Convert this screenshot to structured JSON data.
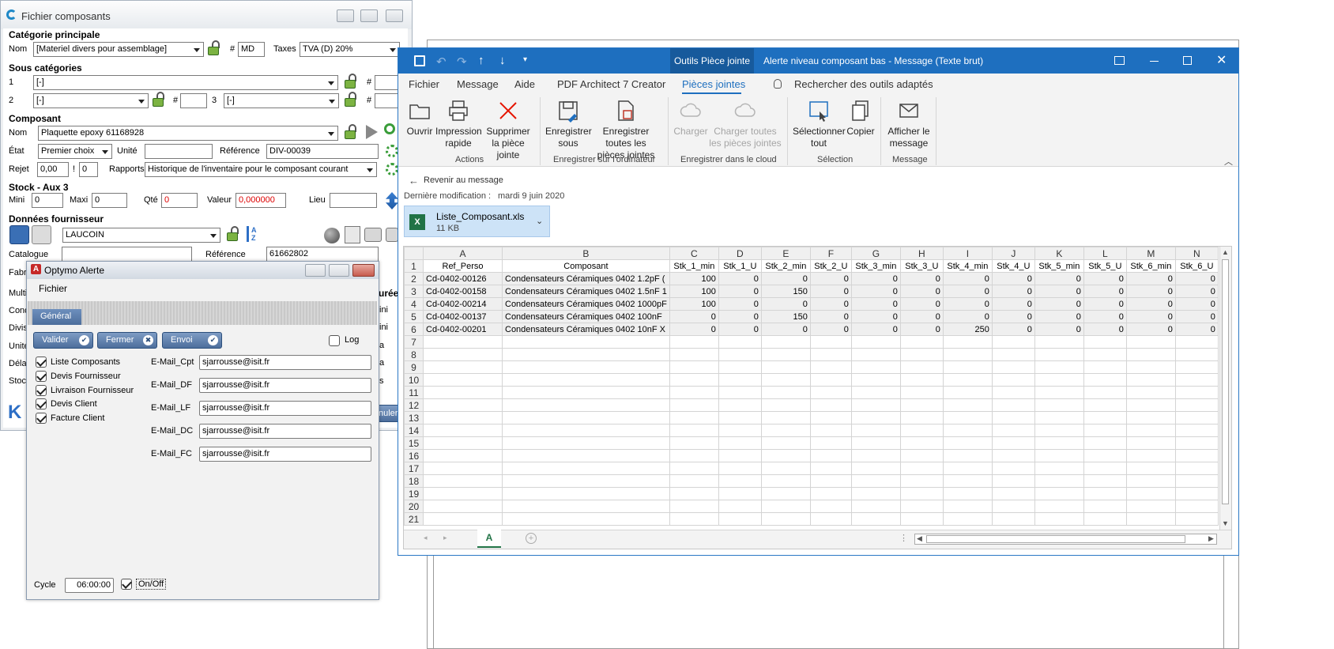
{
  "fichier": {
    "title": "Fichier composants",
    "cat_principale": "Catégorie principale",
    "nom_label": "Nom",
    "nom_value": "[Materiel divers pour assemblage]",
    "hash": "#",
    "md_value": "MD",
    "taxes_label": "Taxes",
    "taxes_value": "TVA (D) 20%",
    "sous_cat": "Sous catégories",
    "sc1_num": "1",
    "sc1_value": "[-]",
    "sc2_num": "2",
    "sc2_value": "[-]",
    "sc3_num": "3",
    "sc3_value": "[-]",
    "composant": "Composant",
    "comp_nom_value": "Plaquette epoxy 61168928",
    "etat_label": "État",
    "etat_value": "Premier choix",
    "unite_label": "Unité",
    "reference_label": "Référence",
    "reference_value": "DIV-00039",
    "rejet_label": "Rejet",
    "rejet_value": "0,00",
    "rejet_bang": "!",
    "rejet_value2": "0",
    "rapports_label": "Rapports",
    "rapports_value": "Historique de l'inventaire pour le composant courant",
    "stock": "Stock - Aux 3",
    "mini_label": "Mini",
    "mini_value": "0",
    "maxi_label": "Maxi",
    "maxi_value": "0",
    "qte_label": "Qté",
    "qte_value": "0",
    "valeur_label": "Valeur",
    "valeur_value": "0,000000",
    "lieu_label": "Lieu",
    "donnees_four": "Données fournisseur",
    "fournisseur_value": "LAUCOIN",
    "catalogue_label": "Catalogue",
    "reference2_value": "61662802",
    "side_labels": [
      "Fabr",
      "Multi",
      "Cond",
      "Divis",
      "Unité",
      "Délai",
      "Stocl"
    ],
    "duree": "urée",
    "right_frags": [
      "ini",
      "ini",
      "a",
      "a",
      "s"
    ],
    "annuler": "nuler"
  },
  "optymo": {
    "title": "Optymo Alerte",
    "menu": "Fichier",
    "tab": "Général",
    "valider": "Valider",
    "fermer": "Fermer",
    "envoi": "Envoi",
    "log": "Log",
    "checks": [
      "Liste Composants",
      "Devis Fournisseur",
      "Livraison Fournisseur",
      "Devis Client",
      "Facture Client"
    ],
    "email_labels": [
      "E-Mail_Cpt",
      "E-Mail_DF",
      "E-Mail_LF",
      "E-Mail_DC",
      "E-Mail_FC"
    ],
    "email_value": "sjarrousse@isit.fr",
    "cycle_label": "Cycle",
    "cycle_value": "06:00:00",
    "onoff": "On/Off"
  },
  "outlook": {
    "tools_tab": "Outils Pièce jointe",
    "title": "Alerte niveau composant bas  -  Message (Texte brut)",
    "tabs": [
      "Fichier",
      "Message",
      "Aide",
      "PDF Architect 7 Creator",
      "Pièces jointes"
    ],
    "search": "Rechercher des outils adaptés",
    "buttons": {
      "ouvrir": "Ouvrir",
      "impression": "Impression rapide",
      "supprimer": "Supprimer la pièce jointe",
      "enreg_sous": "Enregistrer sous",
      "enreg_toutes": "Enregistrer toutes les pièces jointes",
      "charger": "Charger",
      "charger_toutes": "Charger toutes les pièces jointes",
      "selectionner": "Sélectionner tout",
      "copier": "Copier",
      "afficher": "Afficher le message"
    },
    "groups": [
      "Actions",
      "Enregistrer sur l'ordinateur",
      "Enregistrer dans le cloud",
      "Sélection",
      "Message"
    ],
    "back": "Revenir au message",
    "modif_label": "Dernière modification :",
    "modif_value": "mardi 9 juin 2020",
    "attach_name": "Liste_Composant.xls",
    "attach_size": "11 KB",
    "sheet_tab": "A"
  },
  "sheet": {
    "col_letters": [
      "A",
      "B",
      "C",
      "D",
      "E",
      "F",
      "G",
      "H",
      "I",
      "J",
      "K",
      "L",
      "M",
      "N"
    ],
    "header": [
      "Ref_Perso",
      "Composant",
      "Stk_1_min",
      "Stk_1_U",
      "Stk_2_min",
      "Stk_2_U",
      "Stk_3_min",
      "Stk_3_U",
      "Stk_4_min",
      "Stk_4_U",
      "Stk_5_min",
      "Stk_5_U",
      "Stk_6_min",
      "Stk_6_U"
    ],
    "rows": [
      [
        "Cd-0402-00126",
        "Condensateurs Céramiques 0402 1.2pF (",
        "100",
        "0",
        "0",
        "0",
        "0",
        "0",
        "0",
        "0",
        "0",
        "0",
        "0",
        "0"
      ],
      [
        "Cd-0402-00158",
        "Condensateurs Céramiques 0402 1.5nF 1",
        "100",
        "0",
        "150",
        "0",
        "0",
        "0",
        "0",
        "0",
        "0",
        "0",
        "0",
        "0"
      ],
      [
        "Cd-0402-00214",
        "Condensateurs Céramiques 0402 1000pF",
        "100",
        "0",
        "0",
        "0",
        "0",
        "0",
        "0",
        "0",
        "0",
        "0",
        "0",
        "0"
      ],
      [
        "Cd-0402-00137",
        "Condensateurs Céramiques 0402 100nF",
        "0",
        "0",
        "150",
        "0",
        "0",
        "0",
        "0",
        "0",
        "0",
        "0",
        "0",
        "0"
      ],
      [
        "Cd-0402-00201",
        "Condensateurs Céramiques 0402 10nF X",
        "0",
        "0",
        "0",
        "0",
        "0",
        "0",
        "250",
        "0",
        "0",
        "0",
        "0",
        "0"
      ]
    ],
    "empty_rows": [
      "7",
      "8",
      "9",
      "10",
      "11",
      "12",
      "13",
      "14",
      "15",
      "16",
      "17",
      "18",
      "19",
      "20",
      "21"
    ]
  },
  "colors": {
    "outlook_blue": "#1e6fbf",
    "excel_green": "#217346",
    "red": "#e51400"
  }
}
